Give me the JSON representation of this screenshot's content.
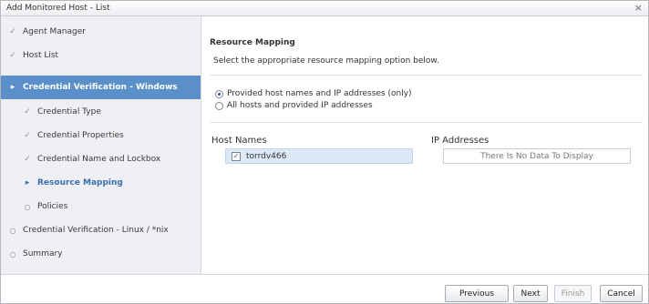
{
  "window": {
    "title": "Add Monitored Host - List",
    "close_label": "×"
  },
  "sidebar": {
    "items": [
      {
        "label": "Agent Manager",
        "state": "done"
      },
      {
        "label": "Host List",
        "state": "done"
      },
      {
        "label": "Credential Verification - Windows",
        "state": "active"
      },
      {
        "label": "Credential Type",
        "state": "done"
      },
      {
        "label": "Credential Properties",
        "state": "done"
      },
      {
        "label": "Credential Name and Lockbox",
        "state": "done"
      },
      {
        "label": "Resource Mapping",
        "state": "current"
      },
      {
        "label": "Policies",
        "state": "pending"
      },
      {
        "label": "Credential Verification - Linux / *nix",
        "state": "pending"
      },
      {
        "label": "Summary",
        "state": "pending"
      }
    ],
    "marks": {
      "done": "✓",
      "active": "▸",
      "current": "▸",
      "pending": "○"
    }
  },
  "main": {
    "section_title": "Resource Mapping",
    "instruction": "Select the appropriate resource mapping option below.",
    "options": [
      {
        "label": "Provided host names and IP addresses (only)",
        "selected": true
      },
      {
        "label": "All hosts and provided IP addresses",
        "selected": false
      }
    ],
    "host_names_label": "Host Names",
    "ip_addresses_label": "IP Addresses",
    "hosts": [
      {
        "name": "torrdv466",
        "checked": true
      }
    ],
    "ip_empty_text": "There Is No Data To Display"
  },
  "footer": {
    "previous_label": "Previous",
    "next_label": "Next",
    "finish_label": "Finish",
    "cancel_label": "Cancel"
  }
}
